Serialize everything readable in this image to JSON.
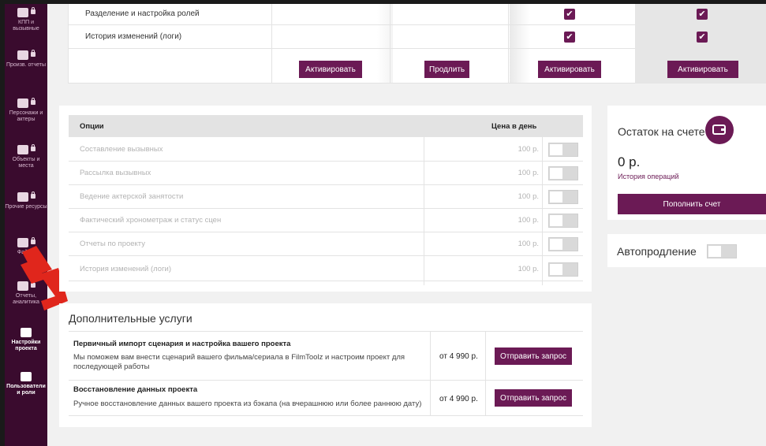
{
  "sidebar": {
    "items": [
      {
        "label": "КПП и вызывные",
        "locked": true
      },
      {
        "label": "Произв. отчеты",
        "locked": true
      },
      {
        "label": "Персонажи и актеры",
        "locked": true
      },
      {
        "label": "Объекты и места",
        "locked": true
      },
      {
        "label": "Прочие ресурсы",
        "locked": true
      },
      {
        "label": "Файлы",
        "locked": true
      },
      {
        "label": "Отчеты, аналитика",
        "locked": true
      },
      {
        "label": "Настройки проекта",
        "locked": false
      },
      {
        "label": "Пользователи и роли",
        "locked": false
      }
    ]
  },
  "features_table": {
    "rows": [
      {
        "name": "Разделение и настройка ролей"
      },
      {
        "name": "История изменений (логи)"
      }
    ],
    "buttons": [
      "Активировать",
      "Продлить",
      "Активировать",
      "Активировать"
    ]
  },
  "options": {
    "header_name": "Опции",
    "header_price": "Цена в день",
    "items": [
      {
        "name": "Составление вызывных",
        "price": "100 р."
      },
      {
        "name": "Рассылка вызывных",
        "price": "100 р."
      },
      {
        "name": "Ведение актерской занятости",
        "price": "100 р."
      },
      {
        "name": "Фактический хронометраж и статус сцен",
        "price": "100 р."
      },
      {
        "name": "Отчеты по проекту",
        "price": "100 р."
      },
      {
        "name": "История изменений (логи)",
        "price": "100 р."
      }
    ]
  },
  "balance": {
    "title": "Остаток на счете",
    "amount": "0 р.",
    "history_link": "История операций",
    "topup_button": "Пополнить счет"
  },
  "autorenew": {
    "label": "Автопродление"
  },
  "extra_services": {
    "title": "Дополнительные услуги",
    "items": [
      {
        "title": "Первичный импорт сценария и настройка вашего проекта",
        "description": "Мы поможем вам внести сценарий вашего фильма/сериала в FilmToolz и настроим проект для последующей работы",
        "price": "от 4 990 р.",
        "button": "Отправить запрос"
      },
      {
        "title": "Восстановление данных проекта",
        "description": "Ручное восстановление данных вашего проекта из бэкапа (на вчерашнюю или более раннюю дату)",
        "price": "от 4 990 р.",
        "button": "Отправить запрос"
      }
    ]
  },
  "colors": {
    "sidebar_bg": "#3a0b2e",
    "accent": "#6b1a55",
    "arrow": "#e0261c",
    "content_bg": "#f1f1f1"
  }
}
